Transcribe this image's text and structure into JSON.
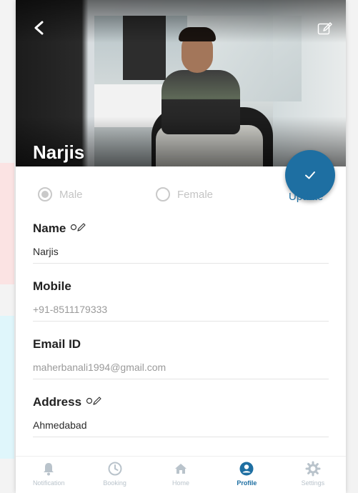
{
  "profile": {
    "name": "Narjis",
    "update_label": "Update"
  },
  "gender": {
    "options": [
      {
        "label": "Male",
        "selected": true
      },
      {
        "label": "Female",
        "selected": false
      }
    ]
  },
  "fields": {
    "name": {
      "label": "Name",
      "value": "Narjis",
      "editable_icon": "edit-pencil-icon"
    },
    "mobile": {
      "label": "Mobile",
      "value": "+91-8511179333"
    },
    "email": {
      "label": "Email ID",
      "value": "maherbanali1994@gmail.com"
    },
    "address": {
      "label": "Address",
      "value": "Ahmedabad",
      "editable_icon": "edit-pencil-icon"
    }
  },
  "tabs": [
    {
      "label": "Notification",
      "icon": "bell-icon",
      "active": false
    },
    {
      "label": "Booking",
      "icon": "clock-icon",
      "active": false
    },
    {
      "label": "Home",
      "icon": "home-icon",
      "active": false
    },
    {
      "label": "Profile",
      "icon": "user-icon",
      "active": true
    },
    {
      "label": "Settings",
      "icon": "gear-icon",
      "active": false
    }
  ],
  "colors": {
    "accent": "#1e6fa2",
    "inactive_tab": "#b9c3cb",
    "radio_inactive": "#c9c9c9"
  }
}
